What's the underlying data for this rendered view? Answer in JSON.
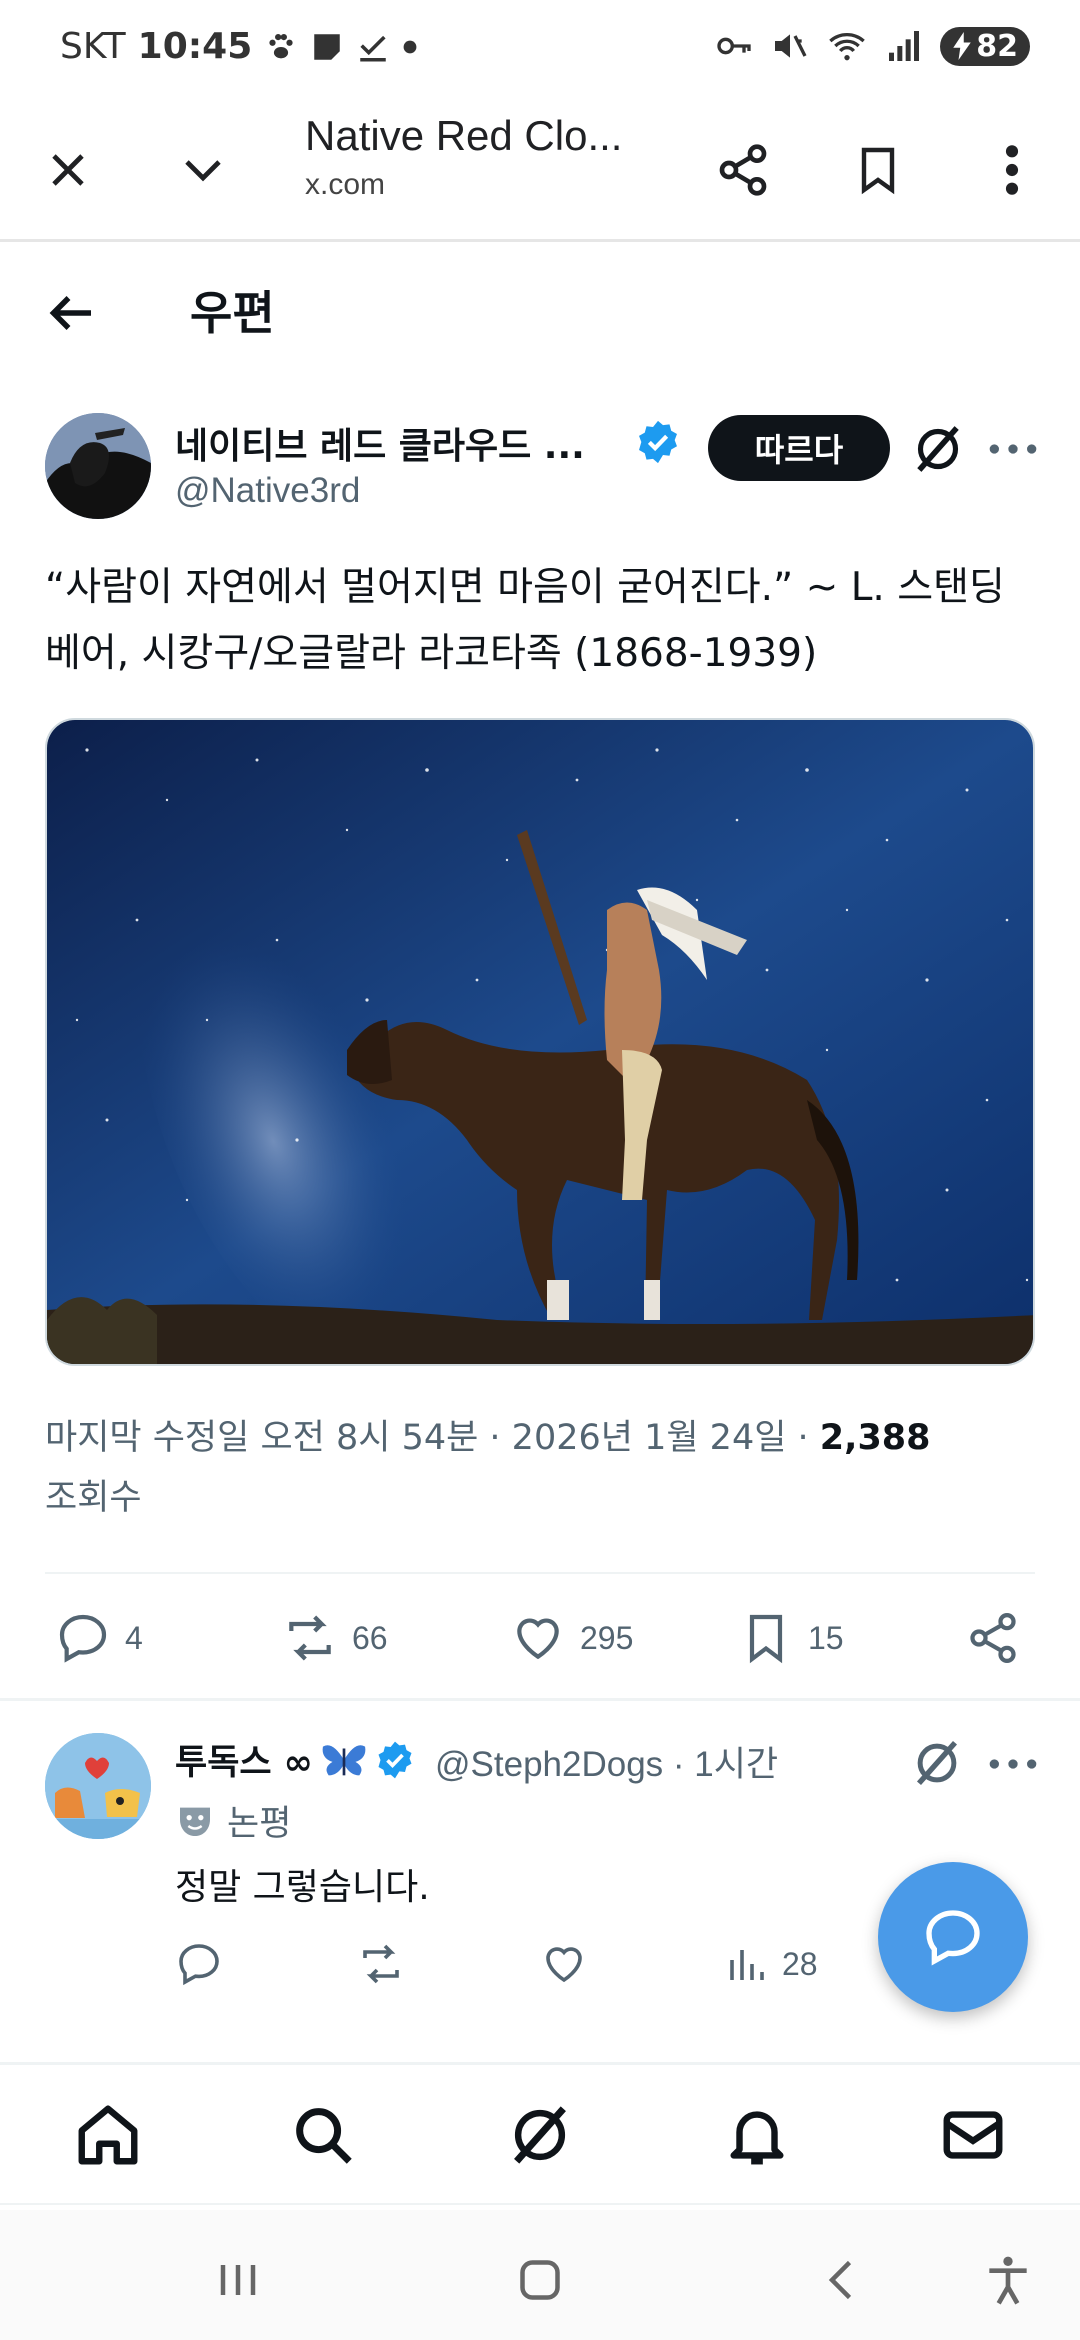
{
  "status_bar": {
    "carrier": "SKT",
    "time": "10:45",
    "battery": "82"
  },
  "browser": {
    "title": "Native Red Clo...",
    "url": "x.com"
  },
  "page": {
    "title": "우편"
  },
  "tweet": {
    "author_name": "네이티브 레드 클라우드 ...",
    "author_handle": "@Native3rd",
    "follow_label": "따르다",
    "text": "“사람이 자연에서 멀어지면 마음이 굳어진다.” ~ L. 스탠딩 베어, 시캉구/오글랄라 라코타족 (1868-1939)",
    "meta_prefix": "마지막 수정일 오전 8시 54분 · 2026년 1월 24일 · ",
    "views_count": "2,388",
    "views_label": "조회수",
    "replies": "4",
    "reposts": "66",
    "likes": "295",
    "bookmarks": "15"
  },
  "reply": {
    "name": "투독스 ∞",
    "handle": "@Steph2Dogs · 1시간",
    "label": "논평",
    "text": "정말 그렇습니다.",
    "views": "28"
  },
  "colors": {
    "accent": "#1d9bf0",
    "fab": "#4a9ae8",
    "text_primary": "#0f1419",
    "text_secondary": "#536471"
  },
  "icons": {
    "browser": [
      "close-icon",
      "chevron-down-icon",
      "share-icon",
      "bookmark-icon",
      "more-vert-icon"
    ],
    "bottom_nav": [
      "home-icon",
      "search-icon",
      "grok-icon",
      "bell-icon",
      "mail-icon"
    ]
  }
}
